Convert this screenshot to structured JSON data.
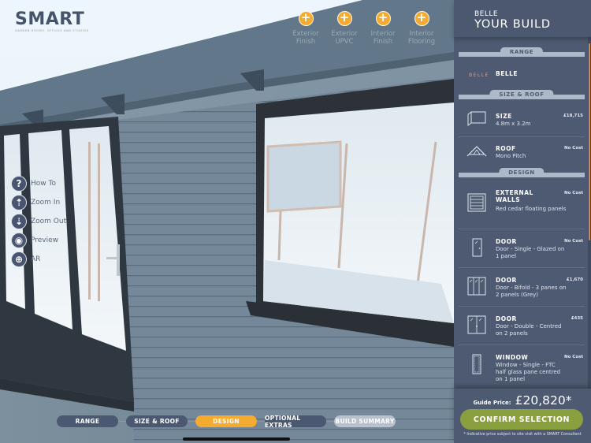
{
  "app": {
    "logo": {
      "word": "SMART",
      "tagline": "GARDEN ROOMS, OFFICES AND STUDIOS"
    }
  },
  "hotspots": [
    {
      "icon": "plus-icon",
      "label": "Exterior Finish"
    },
    {
      "icon": "plus-icon",
      "label": "Exterior UPVC"
    },
    {
      "icon": "plus-icon",
      "label": "Interior Finish"
    },
    {
      "icon": "plus-icon",
      "label": "Interior Flooring"
    }
  ],
  "tools": [
    {
      "icon": "question-icon",
      "label": "How To"
    },
    {
      "icon": "zoom-in-icon",
      "label": "Zoom In"
    },
    {
      "icon": "zoom-out-icon",
      "label": "Zoom Out"
    },
    {
      "icon": "eye-icon",
      "label": "Preview"
    },
    {
      "icon": "ar-icon",
      "label": "AR"
    }
  ],
  "steps": [
    {
      "label": "RANGE",
      "state": "done"
    },
    {
      "label": "SIZE & ROOF",
      "state": "done"
    },
    {
      "label": "DESIGN",
      "state": "active"
    },
    {
      "label": "OPTIONAL EXTRAS",
      "state": "done"
    },
    {
      "label": "BUILD SUMMARY",
      "state": "inactive"
    }
  ],
  "panel": {
    "subtitle": "BELLE",
    "title": "YOUR BUILD",
    "sections": {
      "range": "RANGE",
      "size_roof": "SIZE & ROOF",
      "design": "DESIGN"
    },
    "range_item": {
      "logo_text": "BELLE",
      "name": "BELLE"
    },
    "items": [
      {
        "icon": "building-size-icon",
        "name": "SIZE",
        "desc": "4.8m x 3.2m",
        "price": "£18,715"
      },
      {
        "icon": "roof-icon",
        "name": "ROOF",
        "desc": "Mono Pitch",
        "price": "No Cost"
      },
      {
        "icon": "wall-panels-icon",
        "name": "EXTERNAL WALLS",
        "desc": "Red cedar floating panels",
        "price": "No Cost"
      },
      {
        "icon": "single-door-icon",
        "name": "DOOR",
        "desc": "Door - Single - Glazed on 1 panel",
        "price": "No Cost"
      },
      {
        "icon": "bifold-door-icon",
        "name": "DOOR",
        "desc": "Door - Bifold - 3 panes on 2 panels (Grey)",
        "price": "£1,670"
      },
      {
        "icon": "double-door-icon",
        "name": "DOOR",
        "desc": "Door - Double - Centred on 2 panels",
        "price": "£435"
      },
      {
        "icon": "window-icon",
        "name": "WINDOW",
        "desc": "Window - Single - FTC half glass pane centred on 1 panel",
        "price": "No Cost"
      }
    ],
    "guide_label": "Guide Price:",
    "guide_price": "£20,820*",
    "confirm_label": "CONFIRM SELECTION",
    "disclaimer": "* Indicative price subject to site visit with a SMART Consultant"
  },
  "colors": {
    "accent": "#f5ab30",
    "panel": "#4d5a71",
    "confirm": "#8aa03e",
    "building": "#6f8593"
  }
}
